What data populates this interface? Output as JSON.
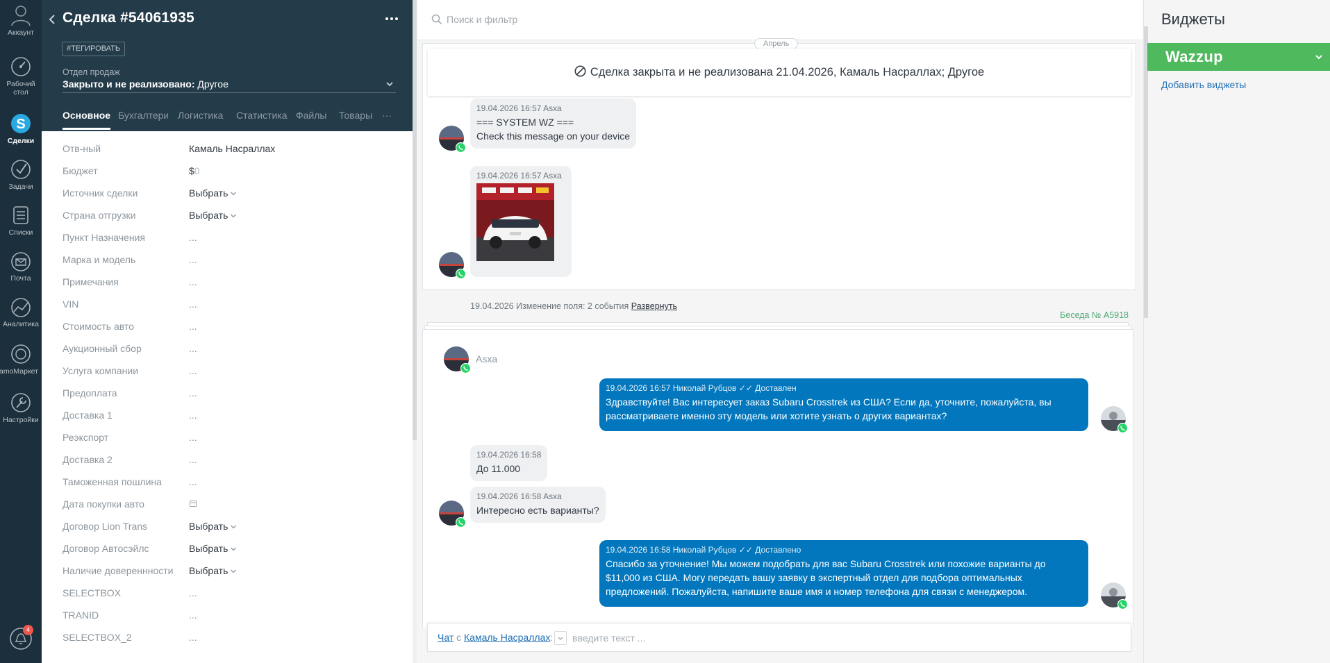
{
  "nav": {
    "items": [
      {
        "label": "Аккаунт",
        "icon": "user-icon"
      },
      {
        "label": "Рабочий стол",
        "icon": "dashboard-icon"
      },
      {
        "label": "Сделки",
        "icon": "deals-icon"
      },
      {
        "label": "Задачи",
        "icon": "tasks-icon"
      },
      {
        "label": "Списки",
        "icon": "lists-icon"
      },
      {
        "label": "Почта",
        "icon": "mail-icon"
      },
      {
        "label": "Аналитика",
        "icon": "analytics-icon"
      },
      {
        "label": "amoМаркет",
        "icon": "market-icon"
      },
      {
        "label": "Настройки",
        "icon": "settings-icon"
      }
    ],
    "notifications_count": "4"
  },
  "deal": {
    "title": "Сделка #54061935",
    "tag_button": "#ТЕГИРОВАТЬ",
    "pipeline": "Отдел продаж",
    "status_label": "Закрыто и не реализовано:",
    "status_value": "Другое",
    "tabs": [
      "Основное",
      "Бухгалтерия",
      "Логистика",
      "Статистика",
      "Файлы",
      "Товары"
    ],
    "tabs_more": "···",
    "fields": [
      {
        "label": "Отв-ный",
        "value": "Камаль Насраллах"
      },
      {
        "label": "Бюджет",
        "value": "$0"
      },
      {
        "label": "Источник сделки",
        "value": "Выбрать"
      },
      {
        "label": "Страна отгрузки",
        "value": "Выбрать"
      },
      {
        "label": "Пункт Назначения",
        "value": "..."
      },
      {
        "label": "Марка и модель",
        "value": "..."
      },
      {
        "label": "Примечания",
        "value": "..."
      },
      {
        "label": "VIN",
        "value": "..."
      },
      {
        "label": "Стоимость авто",
        "value": "..."
      },
      {
        "label": "Аукционный сбор",
        "value": "..."
      },
      {
        "label": "Услуга компании",
        "value": "..."
      },
      {
        "label": "Предоплата",
        "value": "..."
      },
      {
        "label": "Доставка 1",
        "value": "..."
      },
      {
        "label": "Реэкспорт",
        "value": "..."
      },
      {
        "label": "Доставка 2",
        "value": "..."
      },
      {
        "label": "Таможенная пошлина",
        "value": "..."
      },
      {
        "label": "Дата покупки авто",
        "value": ""
      },
      {
        "label": "Договор Lion Trans",
        "value": "Выбрать"
      },
      {
        "label": "Договор Автосэйлс",
        "value": "Выбрать"
      },
      {
        "label": "Наличие довереннности",
        "value": "Выбрать"
      },
      {
        "label": "SELECTBOX",
        "value": "..."
      },
      {
        "label": "TRANID",
        "value": "..."
      },
      {
        "label": "SELECTBOX_2",
        "value": "..."
      }
    ]
  },
  "feed": {
    "search_placeholder": "Поиск и фильтр",
    "month_chip": "Апрель",
    "closed_banner": "Сделка закрыта и не реализована 21.04.2026, Камаль Насраллах; Другое",
    "messages_top": [
      {
        "meta": "19.04.2026 16:57 Asxa",
        "lines": [
          "=== SYSTEM WZ ===",
          "Check this message on your device"
        ]
      },
      {
        "meta": "19.04.2026 16:57 Asxa",
        "image": "car-photo"
      }
    ],
    "conversation_link": "Беседа № A5918",
    "change_note": "19.04.2026 Изменение поля: 2 события",
    "change_expand": "Развернуть",
    "chat_contact_name": "Asxa",
    "chat": [
      {
        "dir": "out",
        "meta": "19.04.2026 16:57 Николай Рубцов",
        "status": "Доставлен",
        "text": "Здравствуйте! Вас интересует заказ Subaru Crosstrek из США? Если да, уточните, пожалуйста, вы рассматриваете именно эту модель или хотите узнать о других вариантах?"
      },
      {
        "dir": "in",
        "meta": "19.04.2026 16:58",
        "text": "До 11.000"
      },
      {
        "dir": "in",
        "meta": "19.04.2026 16:58 Asxa",
        "text": "Интересно есть варианты?"
      },
      {
        "dir": "out",
        "meta": "19.04.2026 16:58 Николай Рубцов",
        "status": "Доставлено",
        "text": "Спасибо за уточнение! Мы можем подобрать для вас Subaru Crosstrek или похожие варианты до $11,000 из США. Могу передать вашу заявку в экспертный отдел для подбора оптимальных предложений. Пожалуйста, напишите ваше имя и номер телефона для связи с менеджером."
      }
    ],
    "input_prefix": "Чат",
    "input_with": "с",
    "input_contact": "Камаль Насраллах",
    "input_colon": ":",
    "input_placeholder": "введите текст ..."
  },
  "widgets": {
    "title": "Виджеты",
    "wazzup": "Wazzup",
    "add_link": "Добавить виджеты"
  },
  "colors": {
    "nav_bg": "#1b2f3c",
    "deal_header_bg": "#243b49",
    "outgoing_bubble": "#0277bd",
    "wazzup_green": "#4fb95e",
    "link_blue": "#1f6fb5",
    "whatsapp_green": "#25d366"
  }
}
